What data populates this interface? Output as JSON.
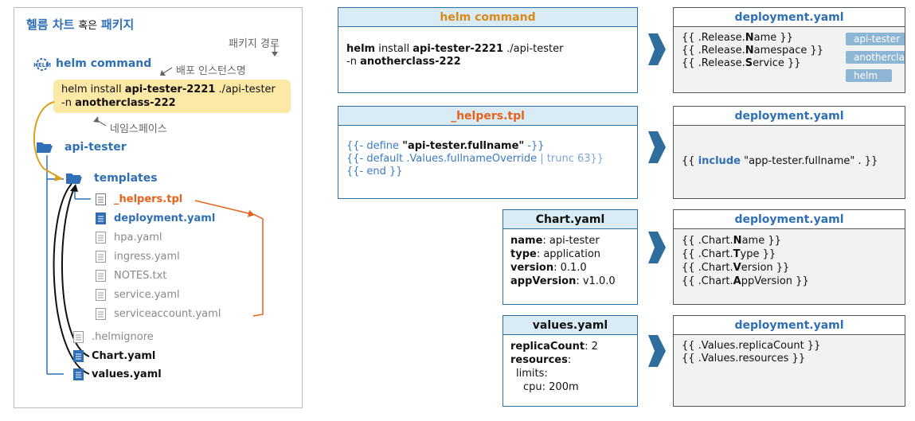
{
  "left": {
    "title_part1": "헬름 차트",
    "title_part2": "혹은",
    "title_part3": "패키지",
    "label_package_path": "패키지 경로",
    "label_release_name": "배포 인스턴스명",
    "label_namespace": "네임스페이스",
    "helm_command_label": "helm command",
    "command_prefix": "helm install ",
    "command_release": "api-tester-2221",
    "command_path": " ./api-tester",
    "command_ns_prefix": "-n ",
    "command_ns": "anotherclass-222",
    "tree": {
      "root": "api-tester",
      "templates": "templates",
      "files": [
        "_helpers.tpl",
        "deployment.yaml",
        "hpa.yaml",
        "ingress.yaml",
        "NOTES.txt",
        "service.yaml",
        "serviceaccount.yaml"
      ],
      "root_files": [
        ".helmignore",
        "Chart.yaml",
        "values.yaml"
      ]
    }
  },
  "helm_command_box": {
    "header": "helm command",
    "line1_a": "helm",
    "line1_b": " install ",
    "line1_c": "api-tester-2221",
    "line1_d": " ./api-tester",
    "line2_a": "-n ",
    "line2_b": "anotherclass-222"
  },
  "helpers_box": {
    "header": "_helpers.tpl",
    "line1_a": "{{- define ",
    "line1_b": "\"api-tester.fullname\"",
    "line1_c": " -}}",
    "line2_a": "{{- default .Values.fullnameOverride ",
    "line2_b": "| trunc 63}}",
    "line3": "{{- end }}"
  },
  "chart_box": {
    "header": "Chart.yaml",
    "rows": [
      {
        "k": "name",
        "v": ": api-tester"
      },
      {
        "k": "type",
        "v": ": application"
      },
      {
        "k": "version",
        "v": ": 0.1.0"
      },
      {
        "k": "appVersion",
        "v": ": v1.0.0"
      }
    ]
  },
  "values_box": {
    "header": "values.yaml",
    "r1k": "replicaCount",
    "r1v": ": 2",
    "r2k": "resources",
    "r2v": ":",
    "r3": "limits:",
    "r4": "cpu: 200m"
  },
  "deploy1": {
    "header": "deployment.yaml",
    "l1a": "{{ .Release.",
    "l1b": "N",
    "l1c": "ame }}",
    "l2a": "{{ .Release.",
    "l2b": "N",
    "l2c": "amespace }}",
    "l3a": "{{ .Release.",
    "l3b": "S",
    "l3c": "ervice }}",
    "tags": [
      "api-tester",
      "anotherclass",
      "helm"
    ]
  },
  "deploy2": {
    "header": "deployment.yaml",
    "l1a": "{{ ",
    "l1b": "include",
    "l1c": " \"app-tester.fullname\" . }}"
  },
  "deploy3": {
    "header": "deployment.yaml",
    "l1a": "{{ .Chart.",
    "l1b": "N",
    "l1c": "ame }}",
    "l2a": "{{ .Chart.",
    "l2b": "T",
    "l2c": "ype }}",
    "l3a": "{{ .Chart.",
    "l3b": "V",
    "l3c": "ersion }}",
    "l4a": "{{ .Chart.",
    "l4b": "A",
    "l4c": "ppVersion }}"
  },
  "deploy4": {
    "header": "deployment.yaml",
    "l1": "{{ .Values.replicaCount }}",
    "l2": "{{ .Values.resources }}"
  },
  "colors": {
    "blue_title": "#2f6fb5",
    "orange": "#e8611a",
    "gold": "#d98a1a",
    "header_bg": "#d9ecf6",
    "arrow": "#2f6d9c",
    "highlight": "#fde9a6"
  }
}
